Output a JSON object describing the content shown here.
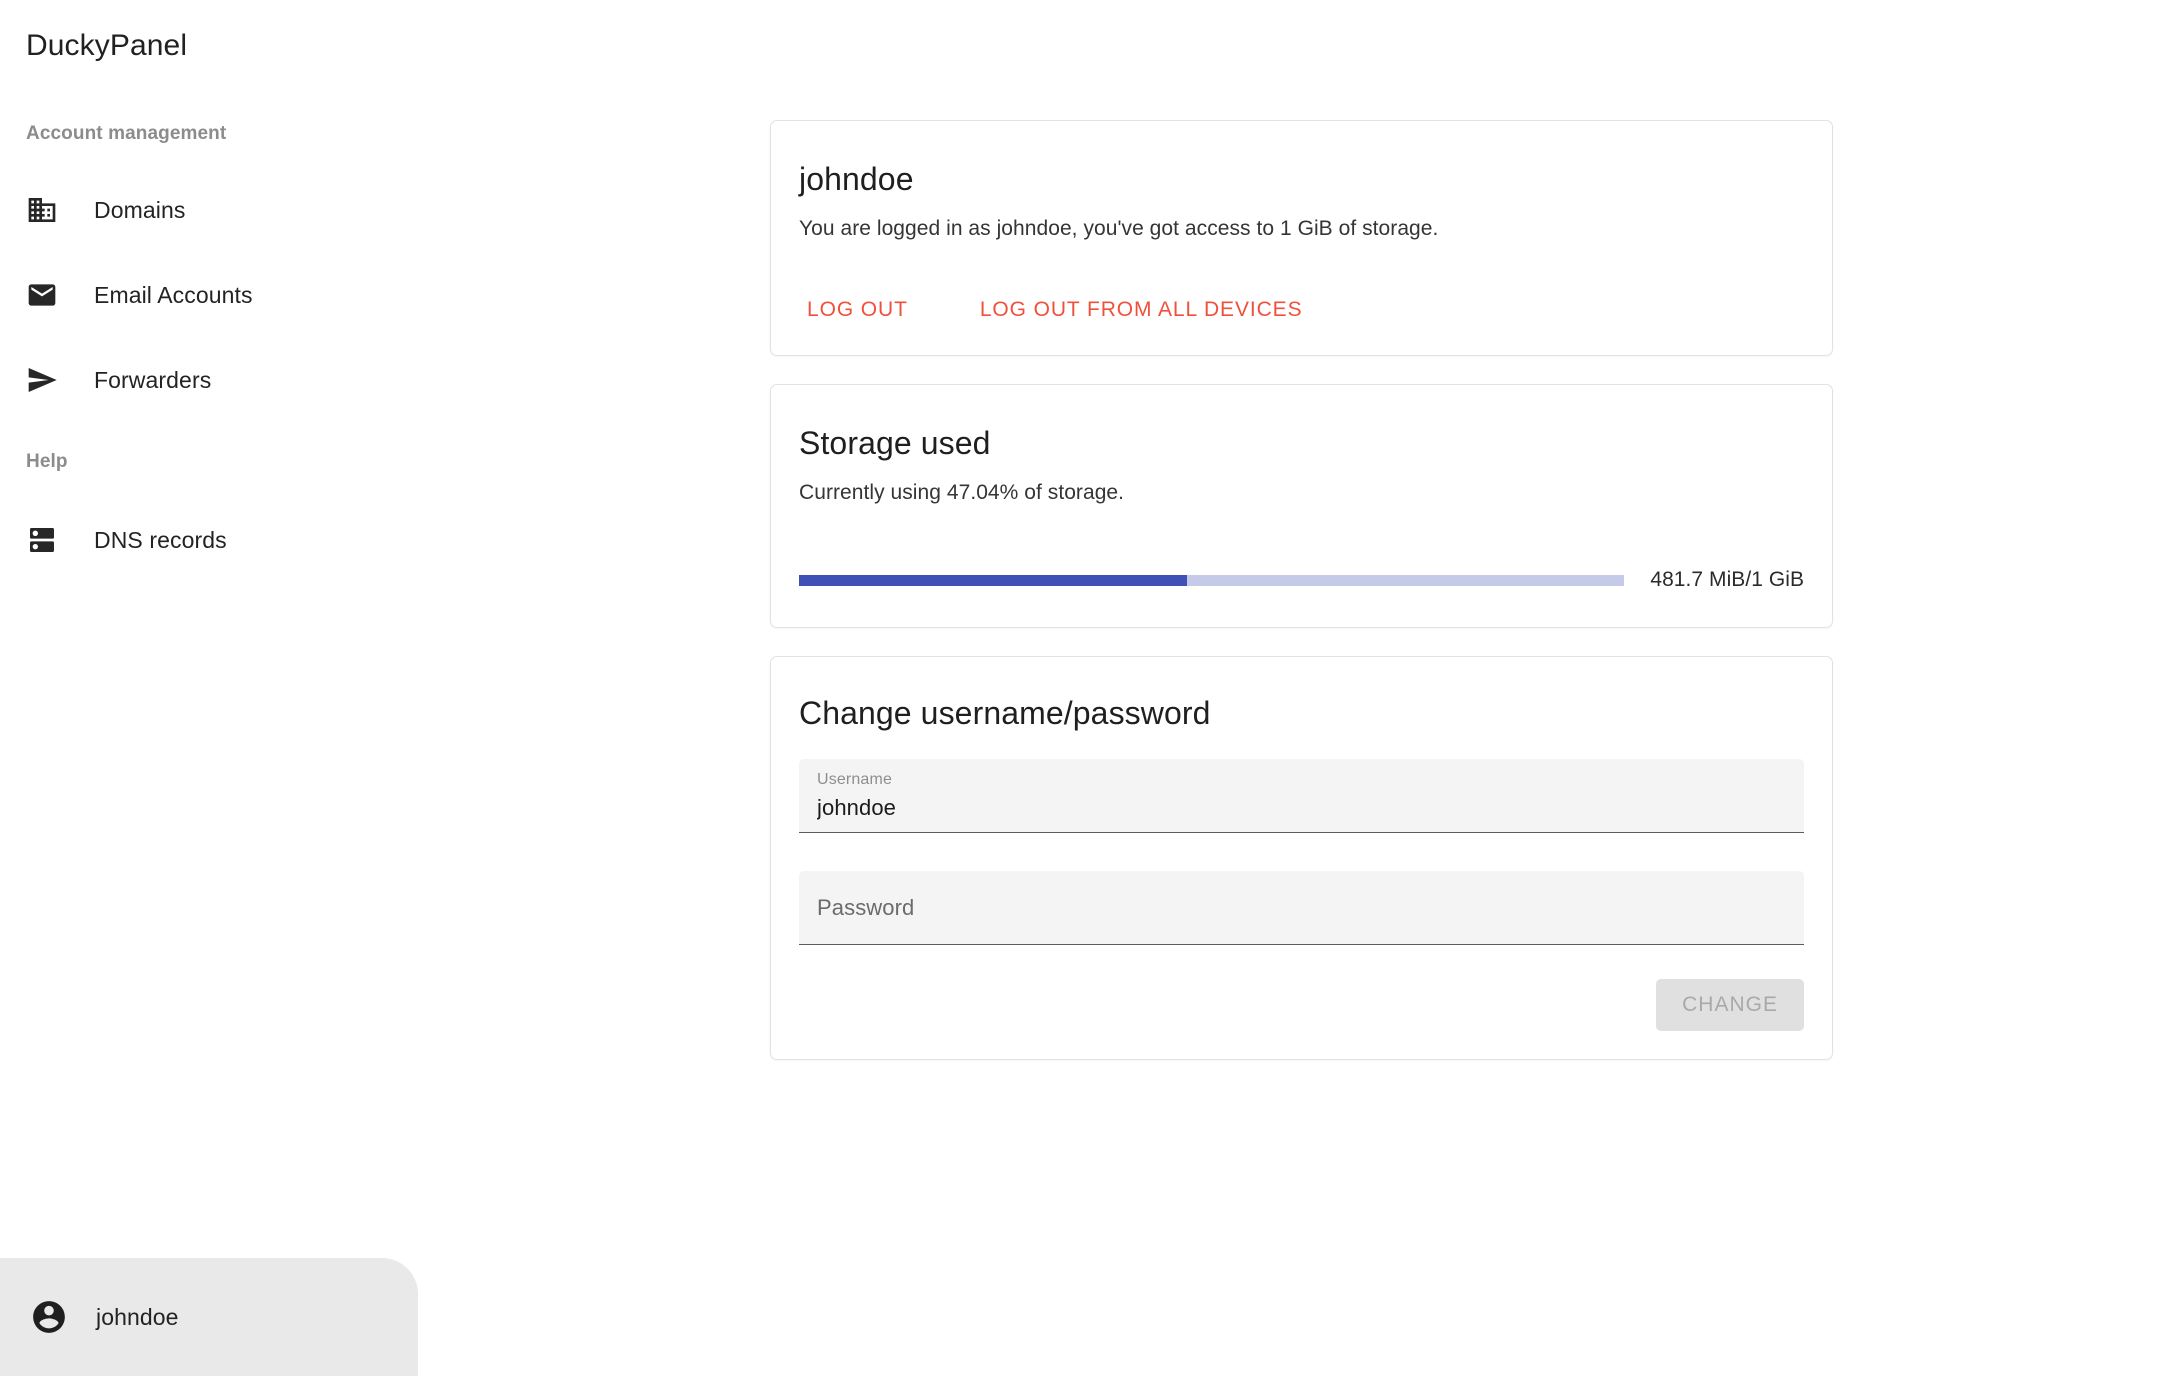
{
  "app": {
    "brand": "DuckyPanel"
  },
  "sidebar": {
    "sections": [
      {
        "label": "Account management"
      },
      {
        "label": "Help"
      }
    ],
    "items": [
      {
        "label": "Domains",
        "icon": "domain-icon"
      },
      {
        "label": "Email Accounts",
        "icon": "email-icon"
      },
      {
        "label": "Forwarders",
        "icon": "send-icon"
      },
      {
        "label": "DNS records",
        "icon": "dns-icon"
      }
    ],
    "user_chip": {
      "label": "johndoe",
      "icon": "account-circle-icon"
    }
  },
  "main": {
    "account_card": {
      "title": "johndoe",
      "subtitle": "You are logged in as johndoe, you've got access to 1 GiB of storage.",
      "logout_label": "LOG OUT",
      "logout_all_label": "LOG OUT FROM ALL DEVICES",
      "link_color": "#F0513C"
    },
    "storage_card": {
      "title": "Storage used",
      "subtitle": "Currently using 47.04% of storage.",
      "percent": 47.04,
      "percent_text": "47.04%",
      "usage_label": "481.7 MiB/1 GiB",
      "used": "481.7 MiB",
      "total": "1 GiB",
      "fill_color": "#3F51B5",
      "track_color": "#C5CAE9"
    },
    "change_card": {
      "title": "Change username/password",
      "username_label": "Username",
      "username_value": "johndoe",
      "password_label": "Password",
      "password_placeholder": "Password",
      "password_value": "",
      "submit_label": "CHANGE"
    }
  }
}
